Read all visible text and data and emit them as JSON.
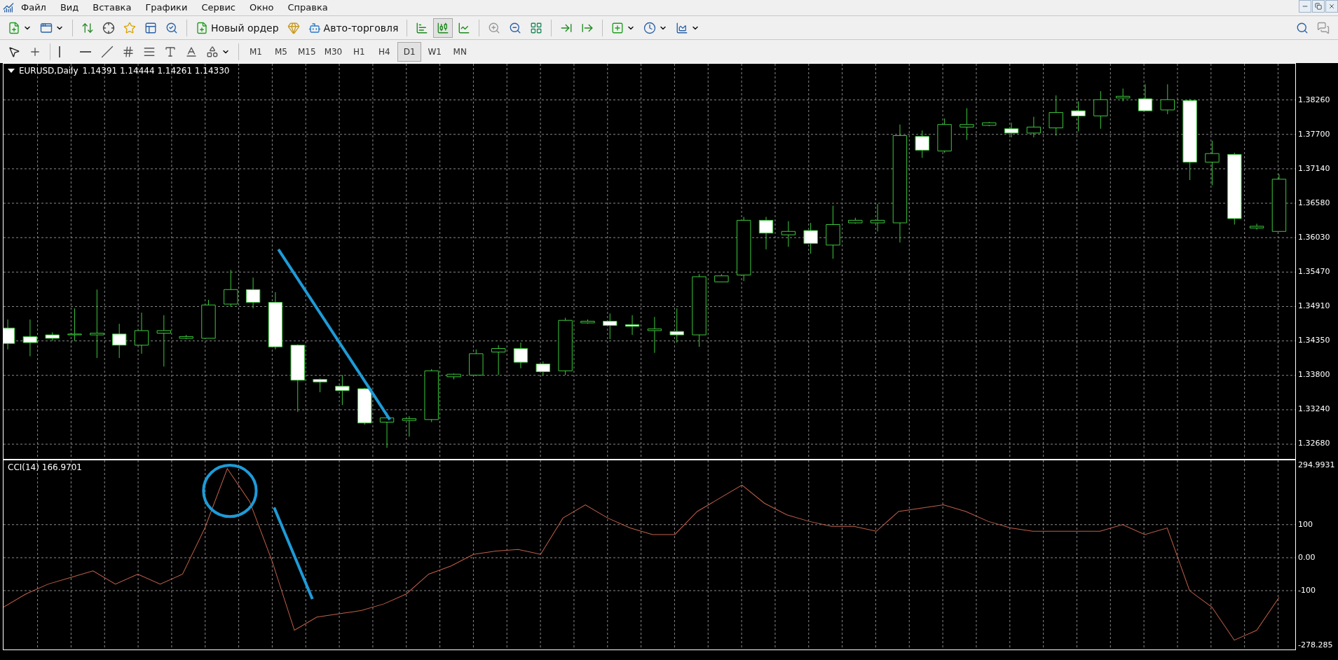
{
  "menu": [
    "Файл",
    "Вид",
    "Вставка",
    "Графики",
    "Сервис",
    "Окно",
    "Справка"
  ],
  "toolbar": {
    "new_order": "Новый ордер",
    "auto_trading": "Авто-торговля",
    "chart_types": [
      {
        "selected": false
      },
      {
        "selected": true
      },
      {
        "selected": false
      }
    ]
  },
  "timeframes": [
    {
      "label": "M1",
      "selected": false
    },
    {
      "label": "M5",
      "selected": false
    },
    {
      "label": "M15",
      "selected": false
    },
    {
      "label": "M30",
      "selected": false
    },
    {
      "label": "H1",
      "selected": false
    },
    {
      "label": "H4",
      "selected": false
    },
    {
      "label": "D1",
      "selected": true
    },
    {
      "label": "W1",
      "selected": false
    },
    {
      "label": "MN",
      "selected": false
    }
  ],
  "main_chart": {
    "symbol": "EURUSD,Daily",
    "quotes": "1.14391 1.14444 1.14261 1.14330",
    "price_axis": [
      "1.38260",
      "1.37700",
      "1.37140",
      "1.36580",
      "1.36030",
      "1.35470",
      "1.34910",
      "1.34350",
      "1.33800",
      "1.33240",
      "1.32680"
    ]
  },
  "indicator": {
    "chart_data": {
      "type": "line",
      "title": "CCI(14) 166.9701",
      "grid": true,
      "ylim": [
        -278.2855,
        294.9931
      ],
      "yticks": [
        {
          "value": 294.9931,
          "label": "294.9931"
        },
        {
          "value": 100,
          "label": "100"
        },
        {
          "value": 0,
          "label": "0.00"
        },
        {
          "value": -100,
          "label": "-100"
        },
        {
          "value": -278.2855,
          "label": "-278.285"
        }
      ],
      "series": [
        {
          "color": "#c0604a",
          "values": [
            -150,
            -110,
            -80,
            -60,
            -40,
            -80,
            -50,
            -80,
            -50,
            90,
            270,
            170,
            -10,
            -220,
            -180,
            -170,
            -160,
            -140,
            -110,
            -50,
            -25,
            10,
            20,
            25,
            10,
            120,
            160,
            120,
            90,
            70,
            70,
            140,
            180,
            220,
            165,
            130,
            110,
            95,
            95,
            80,
            140,
            150,
            160,
            140,
            110,
            90,
            80,
            80,
            80,
            80,
            100,
            70,
            90,
            -100,
            -150,
            -250,
            -220,
            -120
          ]
        }
      ]
    }
  }
}
